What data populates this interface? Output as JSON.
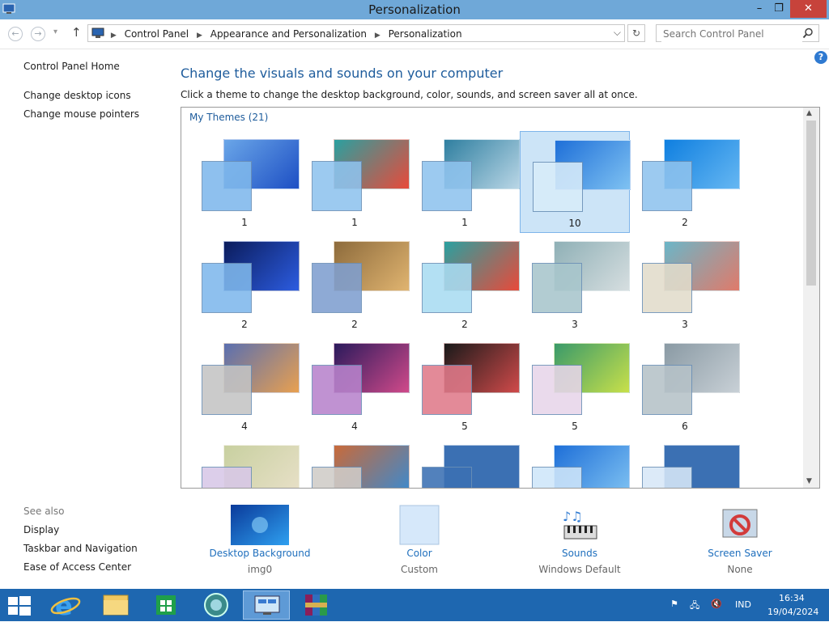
{
  "window": {
    "title": "Personalization",
    "minimize": "–",
    "restore": "❐",
    "close": "✕"
  },
  "nav": {
    "back": "←",
    "forward": "→",
    "up": "↑",
    "recent": "▾",
    "breadcrumbs": [
      "Control Panel",
      "Appearance and Personalization",
      "Personalization"
    ],
    "dropdown": "⌵",
    "refresh": "↻",
    "search_placeholder": "Search Control Panel"
  },
  "help": "?",
  "sidebar": {
    "home": "Control Panel Home",
    "links": [
      "Change desktop icons",
      "Change mouse pointers"
    ],
    "see_also_heading": "See also",
    "see_also": [
      "Display",
      "Taskbar and Navigation",
      "Ease of Access Center"
    ]
  },
  "main": {
    "heading": "Change the visuals and sounds on your computer",
    "subtext": "Click a theme to change the desktop background, color, sounds, and screen saver all at once.",
    "group_label": "My Themes (21)",
    "themes": [
      {
        "name": "1",
        "bg": "#6aa6e8",
        "accent": "#1d4fc4",
        "overlay": "#7fb8ec"
      },
      {
        "name": "1",
        "bg": "#2aa0a0",
        "accent": "#e84a3a",
        "overlay": "#8fc3ee"
      },
      {
        "name": "1",
        "bg": "#2f7fa0",
        "accent": "#b9d6e6",
        "overlay": "#8fc3ee"
      },
      {
        "name": "10",
        "bg": "#1e6fd8",
        "accent": "#7fc2f2",
        "overlay": "#d8ecfa"
      },
      {
        "name": "2",
        "bg": "#0f7fe0",
        "accent": "#66b7f2",
        "overlay": "#8fc3ee"
      },
      {
        "name": "2",
        "bg": "#0b1c5c",
        "accent": "#2c5ce0",
        "overlay": "#7fb8ec"
      },
      {
        "name": "2",
        "bg": "#8d6b3c",
        "accent": "#e0b470",
        "overlay": "#7f9fd0"
      },
      {
        "name": "2",
        "bg": "#2aa0a0",
        "accent": "#e84a3a",
        "overlay": "#a9dcf2"
      },
      {
        "name": "3",
        "bg": "#8fb0b6",
        "accent": "#d6dee0",
        "overlay": "#a8c6cc"
      },
      {
        "name": "3",
        "bg": "#6bb6c8",
        "accent": "#e07a6a",
        "overlay": "#e2dccb"
      },
      {
        "name": "4",
        "bg": "#5a6fb0",
        "accent": "#e8a050",
        "overlay": "#c4c4c4"
      },
      {
        "name": "4",
        "bg": "#2b1a5c",
        "accent": "#d04a8a",
        "overlay": "#b883cc"
      },
      {
        "name": "5",
        "bg": "#1a1a1a",
        "accent": "#d04a4a",
        "overlay": "#e07a8a"
      },
      {
        "name": "5",
        "bg": "#3a9a6a",
        "accent": "#c8e04a",
        "overlay": "#e8d6ea"
      },
      {
        "name": "6",
        "bg": "#8a9aa4",
        "accent": "#c8d0d6",
        "overlay": "#b6c2c8"
      },
      {
        "name": "",
        "bg": "#c8d0a0",
        "accent": "#e8e0c8",
        "overlay": "#d8c8e8"
      },
      {
        "name": "",
        "bg": "#c86a3a",
        "accent": "#3a8ad0",
        "overlay": "#d0ccc8"
      },
      {
        "name": "",
        "bg": "#3b70b3",
        "accent": "#3b70b3",
        "overlay": "#3b70b3"
      },
      {
        "name": "",
        "bg": "#1e6fd8",
        "accent": "#7fc2f2",
        "overlay": "#cfe6fa"
      },
      {
        "name": "",
        "bg": "#3b70b3",
        "accent": "#3b70b3",
        "overlay": "#d8e8f8"
      }
    ]
  },
  "bottom": [
    {
      "label": "Desktop Background",
      "value": "img0",
      "icon": "desktop-background-icon"
    },
    {
      "label": "Color",
      "value": "Custom",
      "icon": "color-swatch-icon"
    },
    {
      "label": "Sounds",
      "value": "Windows Default",
      "icon": "sounds-icon"
    },
    {
      "label": "Screen Saver",
      "value": "None",
      "icon": "screen-saver-icon"
    }
  ],
  "taskbar": {
    "apps": [
      "start-icon",
      "internet-explorer-icon",
      "file-explorer-icon",
      "store-icon",
      "media-player-icon",
      "control-panel-icon",
      "winrar-icon"
    ],
    "language": "IND",
    "time": "16:34",
    "date": "19/04/2024"
  },
  "colors": {
    "titlebar": "#6fa8d8",
    "link_blue": "#1f6fbd",
    "heading_blue": "#1e5c9c",
    "taskbar": "#1e67b0",
    "close": "#c7433b"
  }
}
